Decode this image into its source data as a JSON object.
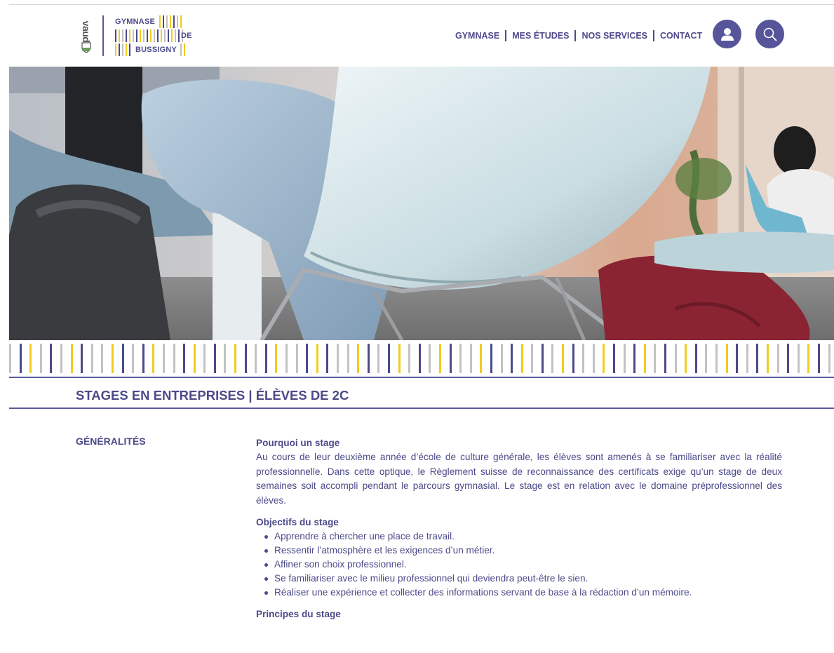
{
  "header": {
    "canton_word": "vaud",
    "logo_lines": [
      "GYMNASE",
      "DE",
      "BUSSIGNY"
    ],
    "nav": [
      "GYMNASE",
      "MES ÉTUDES",
      "NOS SERVICES",
      "CONTACT"
    ],
    "icons": [
      "user-icon",
      "search-icon"
    ]
  },
  "colors": {
    "brand": "#4b4a8a",
    "button": "#56559a",
    "yellow": "#f2cc1f",
    "grey": "#c2c2c2"
  },
  "stripe_colors": [
    "#c2c2c2",
    "#4b4a8a",
    "#f2cc1f",
    "#c2c2c2",
    "#4b4a8a",
    "#c2c2c2",
    "#f2cc1f",
    "#4b4a8a",
    "#c2c2c2",
    "#c2c2c2",
    "#f2cc1f",
    "#4b4a8a",
    "#c2c2c2",
    "#4b4a8a",
    "#f2cc1f",
    "#c2c2c2",
    "#c2c2c2",
    "#4b4a8a",
    "#f2cc1f",
    "#c2c2c2",
    "#4b4a8a",
    "#c2c2c2",
    "#f2cc1f",
    "#4b4a8a",
    "#c2c2c2",
    "#4b4a8a",
    "#f2cc1f",
    "#c2c2c2",
    "#c2c2c2",
    "#4b4a8a",
    "#f2cc1f",
    "#4b4a8a",
    "#c2c2c2",
    "#c2c2c2",
    "#f2cc1f",
    "#4b4a8a",
    "#c2c2c2",
    "#4b4a8a",
    "#f2cc1f",
    "#c2c2c2",
    "#4b4a8a",
    "#c2c2c2",
    "#f2cc1f",
    "#4b4a8a",
    "#c2c2c2",
    "#c2c2c2",
    "#f2cc1f",
    "#4b4a8a",
    "#c2c2c2",
    "#4b4a8a",
    "#f2cc1f",
    "#c2c2c2",
    "#4b4a8a",
    "#c2c2c2",
    "#f2cc1f",
    "#4b4a8a",
    "#c2c2c2",
    "#c2c2c2",
    "#f2cc1f",
    "#4b4a8a",
    "#c2c2c2",
    "#4b4a8a",
    "#f2cc1f",
    "#c2c2c2",
    "#4b4a8a",
    "#c2c2c2",
    "#f2cc1f",
    "#4b4a8a",
    "#c2c2c2",
    "#c2c2c2",
    "#f2cc1f",
    "#4b4a8a",
    "#c2c2c2",
    "#4b4a8a",
    "#f2cc1f",
    "#c2c2c2",
    "#4b4a8a",
    "#c2c2c2",
    "#f2cc1f",
    "#4b4a8a",
    "#c2c2c2"
  ],
  "page": {
    "title": "STAGES EN ENTREPRISES | ÉLÈVES DE 2C",
    "section_label": "GÉNÉRALITÉS",
    "why_heading": "Pourquoi un stage",
    "why_text": "Au cours de leur deuxième année d’école de culture générale, les élèves sont amenés à se familiariser avec la réalité professionnelle. Dans cette optique, le Règlement suisse de reconnaissance des certificats exige qu’un stage de deux semaines soit accompli pendant le parcours gymnasial. Le stage est en relation avec le domaine préprofessionnel des élèves.",
    "objectives_heading": "Objectifs du stage",
    "objectives": [
      "Apprendre à chercher une place de travail.",
      "Ressentir l’atmosphère et les exigences d’un métier.",
      "Affiner son choix professionnel.",
      "Se familiariser avec le milieu professionnel qui deviendra peut-être le sien.",
      "Réaliser une expérience et collecter des informations servant de base à la rédaction d’un mémoire."
    ],
    "principles_heading": "Principes du stage"
  }
}
